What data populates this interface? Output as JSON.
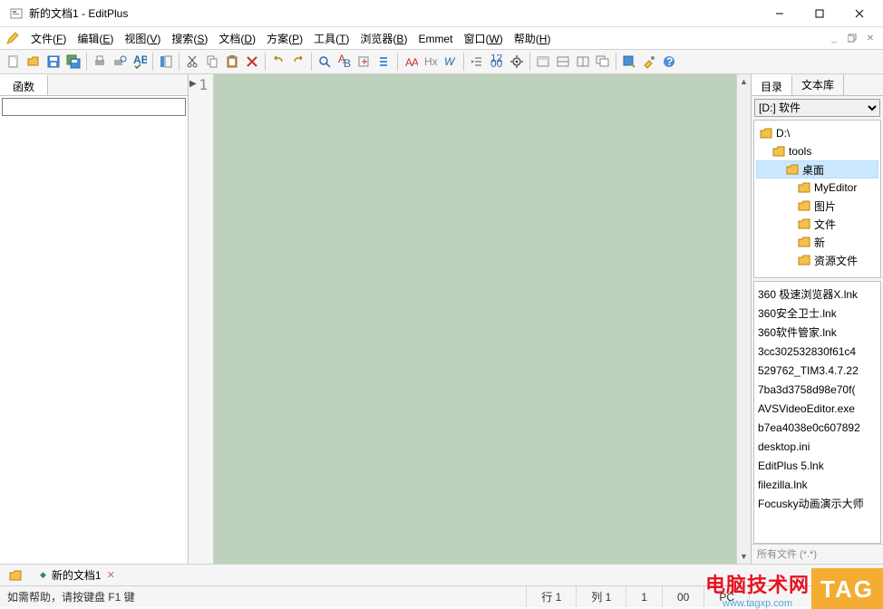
{
  "window": {
    "title": "新的文档1 - EditPlus"
  },
  "menu": {
    "items": [
      {
        "label": "文件",
        "key": "F"
      },
      {
        "label": "编辑",
        "key": "E"
      },
      {
        "label": "视图",
        "key": "V"
      },
      {
        "label": "搜索",
        "key": "S"
      },
      {
        "label": "文档",
        "key": "D"
      },
      {
        "label": "方案",
        "key": "P"
      },
      {
        "label": "工具",
        "key": "T"
      },
      {
        "label": "浏览器",
        "key": "B"
      },
      {
        "label": "Emmet",
        "key": ""
      },
      {
        "label": "窗口",
        "key": "W"
      },
      {
        "label": "帮助",
        "key": "H"
      }
    ]
  },
  "leftPanel": {
    "tab": "函数",
    "inputValue": ""
  },
  "editor": {
    "lineNumber": "1"
  },
  "rightPanel": {
    "tabs": [
      "目录",
      "文本库"
    ],
    "activeTab": 0,
    "drive": "[D:] 软件",
    "tree": [
      {
        "label": "D:\\",
        "indent": 0,
        "sel": false
      },
      {
        "label": "tools",
        "indent": 1,
        "sel": false
      },
      {
        "label": "桌面",
        "indent": 2,
        "sel": true
      },
      {
        "label": "MyEditor",
        "indent": 3,
        "sel": false
      },
      {
        "label": "图片",
        "indent": 3,
        "sel": false
      },
      {
        "label": "文件",
        "indent": 3,
        "sel": false
      },
      {
        "label": "新",
        "indent": 3,
        "sel": false
      },
      {
        "label": "资源文件",
        "indent": 3,
        "sel": false
      }
    ],
    "files": [
      "360 极速浏览器X.lnk",
      "360安全卫士.lnk",
      "360软件管家.lnk",
      "3cc302532830f61c4",
      "529762_TIM3.4.7.22",
      "7ba3d3758d98e70f(",
      "AVSVideoEditor.exe",
      "b7ea4038e0c607892",
      "desktop.ini",
      "EditPlus 5.lnk",
      "filezilla.lnk",
      "Focusky动画演示大师"
    ],
    "status": "所有文件 (*.*)"
  },
  "docTabs": {
    "items": [
      {
        "label": "新的文档1"
      }
    ]
  },
  "statusBar": {
    "help": "如需帮助，请按键盘 F1 键",
    "row": "行 1",
    "col": "列 1",
    "count": "1",
    "off": "00",
    "mode": "PC"
  },
  "watermark": {
    "cn": "电脑技术网",
    "url": "www.tagxp.com",
    "tag": "TAG"
  }
}
